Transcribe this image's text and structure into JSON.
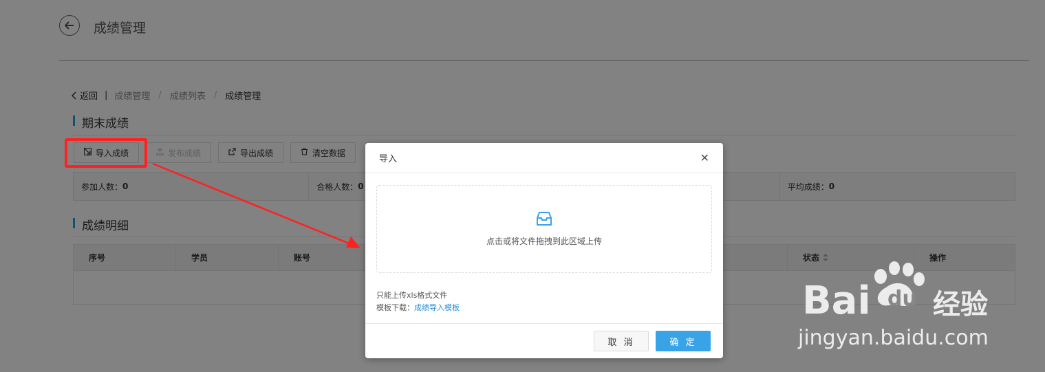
{
  "header": {
    "title": "成绩管理"
  },
  "breadcrumb": {
    "back": "返回",
    "items": [
      "成绩管理",
      "成绩列表"
    ],
    "current": "成绩管理"
  },
  "sections": {
    "final": "期末成绩",
    "detail": "成绩明细"
  },
  "toolbar": {
    "import": "导入成绩",
    "publish": "发布成绩",
    "export": "导出成绩",
    "clear": "清空数据"
  },
  "stats": [
    {
      "label": "参加人数：",
      "value": "0"
    },
    {
      "label": "合格人数：",
      "value": "0"
    },
    {
      "label": "",
      "value": ""
    },
    {
      "label": "平均成绩：",
      "value": "0"
    }
  ],
  "table": {
    "columns": [
      "序号",
      "学员",
      "账号",
      "",
      "状态",
      "操作"
    ]
  },
  "modal": {
    "title": "导入",
    "drop_text": "点击或将文件拖拽到此区域上传",
    "hint": "只能上传xls格式文件",
    "template_label": "模板下载：",
    "template_link": "成绩导入模板",
    "cancel": "取 消",
    "ok": "确 定"
  },
  "watermark": {
    "url": "jingyan.baidu.com"
  },
  "colors": {
    "accent": "#39a3e8",
    "highlight": "#ff2020",
    "link": "#2a8fd9"
  }
}
